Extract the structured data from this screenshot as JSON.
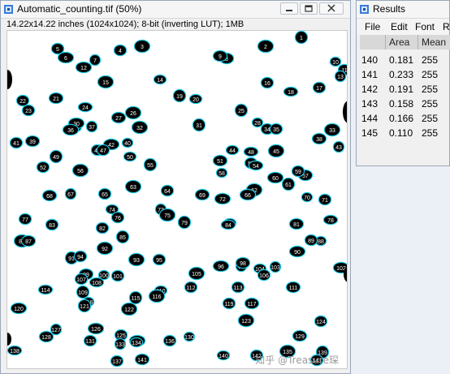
{
  "image_window": {
    "title": "Automatic_counting.tif (50%)",
    "info": "14.22x14.22 inches (1024x1024); 8-bit (inverting LUT); 1MB",
    "controls": [
      "minimize-icon",
      "restore-icon",
      "close-icon"
    ],
    "particle_labels": [
      "1",
      "2",
      "3",
      "4",
      "5",
      "6",
      "7",
      "8",
      "9",
      "10",
      "11",
      "12",
      "13",
      "14",
      "15",
      "16",
      "17",
      "18",
      "19",
      "20",
      "21",
      "22",
      "23",
      "24",
      "25",
      "26",
      "27",
      "28",
      "29",
      "30",
      "31",
      "32",
      "33",
      "34",
      "35",
      "36",
      "37",
      "38",
      "39",
      "40",
      "41",
      "42",
      "43",
      "44",
      "45",
      "46",
      "47",
      "48",
      "49",
      "50",
      "51",
      "52",
      "53",
      "54",
      "55",
      "56",
      "57",
      "58",
      "59",
      "60",
      "61",
      "62",
      "63",
      "64",
      "65",
      "66",
      "67",
      "68",
      "69",
      "70",
      "71",
      "72",
      "73",
      "74",
      "75",
      "76",
      "77",
      "78",
      "79",
      "80",
      "81",
      "82",
      "83",
      "84",
      "85",
      "86",
      "87",
      "88",
      "89",
      "90",
      "91",
      "92",
      "93",
      "94",
      "95",
      "96",
      "97",
      "98",
      "99",
      "100",
      "101",
      "102",
      "103",
      "104",
      "105",
      "106",
      "107",
      "108",
      "109",
      "110",
      "111",
      "112",
      "113",
      "114",
      "115",
      "116",
      "117",
      "118",
      "119",
      "120",
      "121",
      "122",
      "123",
      "124",
      "125",
      "126",
      "127",
      "128",
      "129",
      "130",
      "131",
      "132",
      "133",
      "134",
      "135",
      "136",
      "137",
      "138",
      "139",
      "140",
      "141",
      "142",
      "143",
      "144"
    ]
  },
  "results_window": {
    "title": "Results",
    "menu": [
      "File",
      "Edit",
      "Font",
      "R"
    ],
    "columns": [
      "",
      "Area",
      "Mean"
    ],
    "rows": [
      {
        "id": "140",
        "area": "0.181",
        "mean": "255"
      },
      {
        "id": "141",
        "area": "0.233",
        "mean": "255"
      },
      {
        "id": "142",
        "area": "0.191",
        "mean": "255"
      },
      {
        "id": "143",
        "area": "0.158",
        "mean": "255"
      },
      {
        "id": "144",
        "area": "0.166",
        "mean": "255"
      },
      {
        "id": "145",
        "area": "0.110",
        "mean": "255"
      }
    ]
  },
  "watermark": "知乎 @Treasure琛",
  "colors": {
    "outline": "#1ec8e6",
    "particle": "#000000",
    "background": "#ffffff",
    "label": "#000000"
  }
}
